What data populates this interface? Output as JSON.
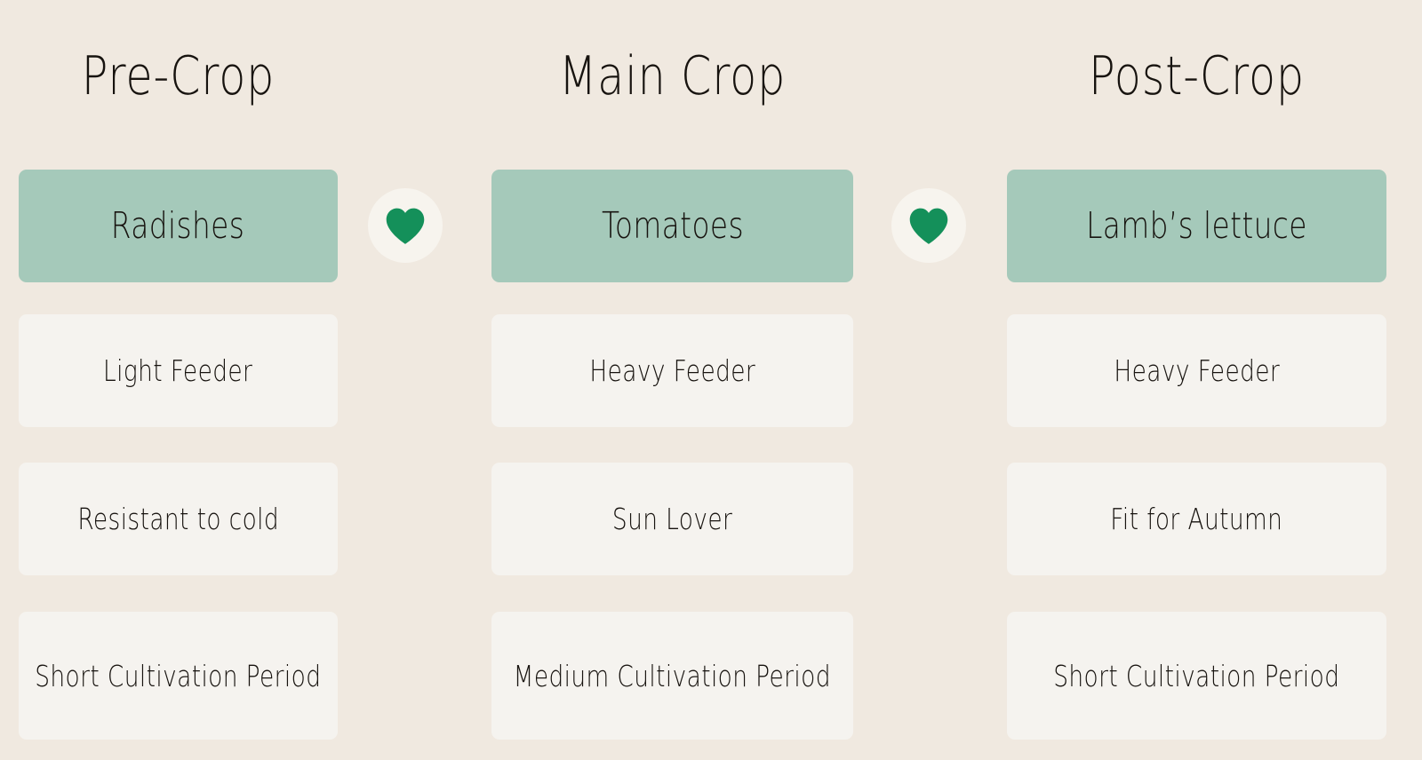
{
  "theme": {
    "background": "#F0E9E0",
    "highlight_card": "#A5C9BA",
    "plain_card": "#F5F3EF",
    "badge_circle": "#F7F4EE",
    "heart_green": "#14905A",
    "text": "#17130F"
  },
  "columns": [
    {
      "header": "Pre-Crop",
      "crop": "Radishes",
      "attributes": [
        "Light Feeder",
        "Resistant to cold",
        "Short Cultivation Period"
      ]
    },
    {
      "header": "Main Crop",
      "crop": "Tomatoes",
      "attributes": [
        "Heavy Feeder",
        "Sun Lover",
        "Medium Cultivation Period"
      ]
    },
    {
      "header": "Post-Crop",
      "crop": "Lamb’s lettuce",
      "attributes": [
        "Heavy Feeder",
        "Fit for Autumn",
        "Short Cultivation Period"
      ]
    }
  ],
  "connectors": [
    {
      "icon": "heart-icon",
      "color": "#14905A"
    },
    {
      "icon": "heart-icon",
      "color": "#14905A"
    }
  ]
}
